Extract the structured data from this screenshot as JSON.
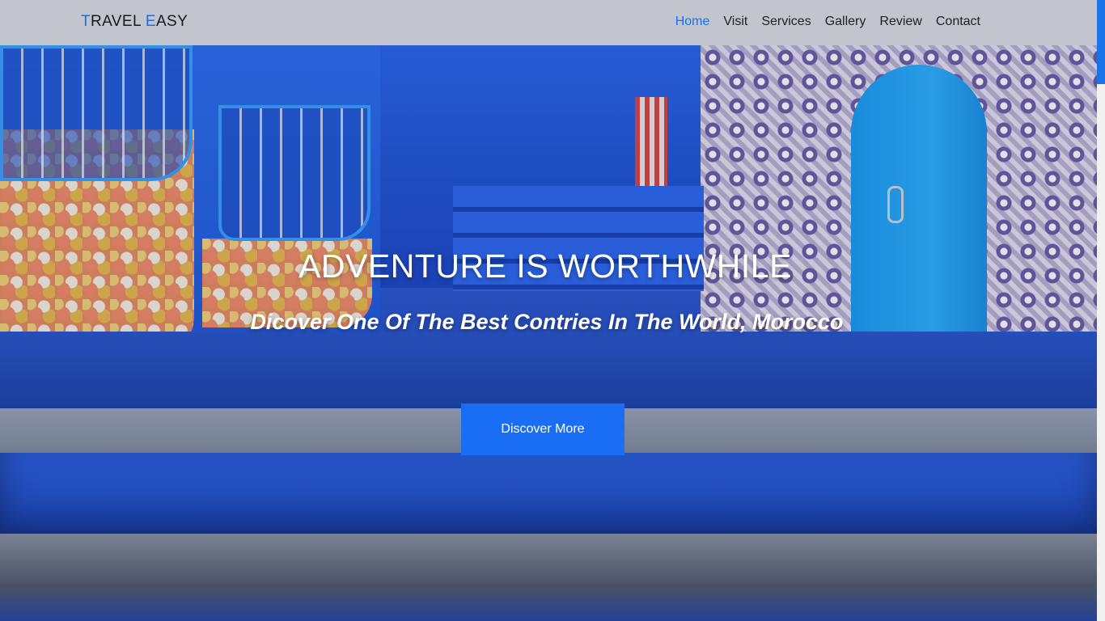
{
  "brand": {
    "logo_first_letter": "T",
    "logo_first_rest": "RAVEL ",
    "logo_second_letter": "E",
    "logo_second_rest": "ASY",
    "accent_color": "#1a6ef5"
  },
  "nav": {
    "items": [
      {
        "label": "Home",
        "active": true
      },
      {
        "label": "Visit",
        "active": false
      },
      {
        "label": "Services",
        "active": false
      },
      {
        "label": "Gallery",
        "active": false
      },
      {
        "label": "Review",
        "active": false
      },
      {
        "label": "Contact",
        "active": false
      }
    ]
  },
  "hero": {
    "title": "ADVENTURE IS WORTHWHILE",
    "subtitle": "Dicover One Of The Best Contries In The World, Morocco",
    "cta_label": "Discover More"
  }
}
